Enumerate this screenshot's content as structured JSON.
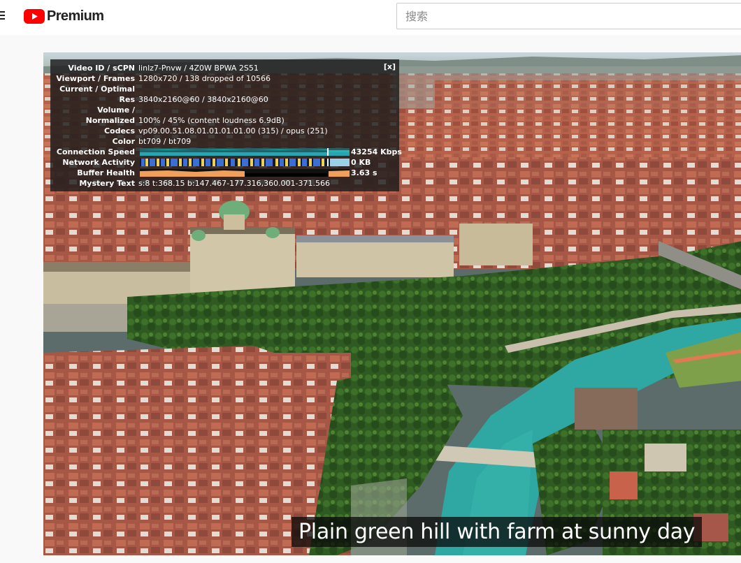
{
  "header": {
    "menu_icon": "hamburger-menu-icon",
    "logo_icon": "youtube-play-logo-icon",
    "logo_text": "Premium",
    "brand_color": "#ff0000",
    "search": {
      "placeholder": "搜索",
      "value": ""
    }
  },
  "stats_for_nerds": {
    "close_label": "[x]",
    "rows": [
      {
        "label": "Video ID / sCPN",
        "value": "linlz7-Pnvw / 4Z0W BPWA 2S51"
      },
      {
        "label": "Viewport / Frames",
        "value": "1280x720 / 138 dropped of 10566"
      },
      {
        "label": "Current / Optimal",
        "value": ""
      },
      {
        "label": "Res",
        "value": "3840x2160@60 / 3840x2160@60"
      },
      {
        "label": "Volume /",
        "value": ""
      },
      {
        "label": "Normalized",
        "value": "100% / 45% (content loudness 6.9dB)"
      },
      {
        "label": "Codecs",
        "value": "vp09.00.51.08.01.01.01.01.00 (315) / opus (251)"
      },
      {
        "label": "Color",
        "value": "bt709 / bt709"
      },
      {
        "label": "Connection Speed",
        "value": "43254 Kbps"
      },
      {
        "label": "Network Activity",
        "value": "0 KB"
      },
      {
        "label": "Buffer Health",
        "value": "3.63 s"
      },
      {
        "label": "Mystery Text",
        "value": "s:8 t:368.15 b:147.467-177.316,360.001-371.566"
      }
    ],
    "graph_colors": {
      "connection": "#1fb9b0",
      "network": "#3b6fd6",
      "buffer": "#f0a05a"
    }
  },
  "caption": {
    "text": "Plain green hill with farm at sunny day"
  }
}
